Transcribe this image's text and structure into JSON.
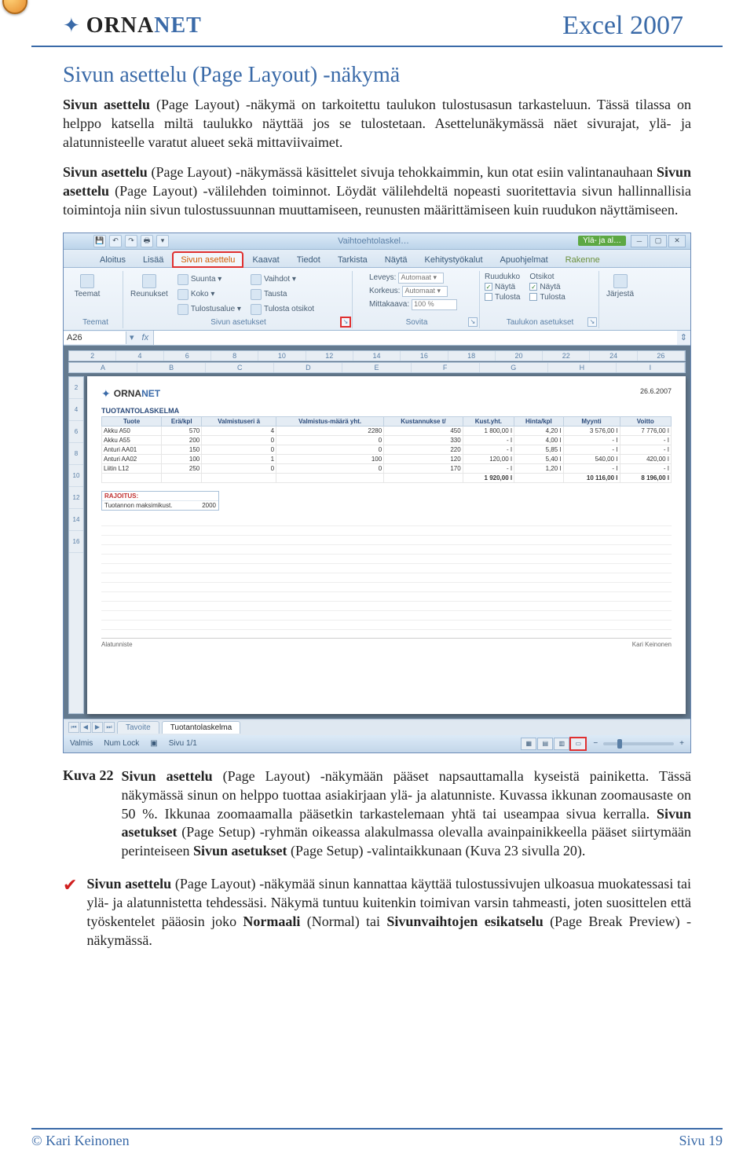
{
  "header": {
    "logo_text_a": "ORNA",
    "logo_text_b": "NET",
    "doc_title": "Excel 2007"
  },
  "section_title": "Sivun asettelu (Page Layout) -näkymä",
  "para1_lead": "Sivun asettelu",
  "para1_rest": " (Page Layout) -näkymä on tarkoitettu taulukon tulostusasun tarkasteluun. Tässä tilassa on helppo katsella miltä taulukko näyttää jos se tulostetaan. Asettelunäkymässä näet sivurajat, ylä- ja alatunnisteelle varatut alueet sekä mittaviivaimet.",
  "para2_lead": "Sivun asettelu",
  "para2_mid1": " (Page Layout) -näkymässä käsittelet sivuja tehokkaimmin, kun otat esiin valintanauhaan ",
  "para2_bold2": "Sivun asettelu",
  "para2_rest": " (Page Layout) -välilehden toiminnot. Löydät välilehdeltä nopeasti suoritettavia sivun hallinnallisia toimintoja niin sivun tulostussuunnan muuttamiseen, reunusten määrittämiseen kuin ruudukon näyttämiseen.",
  "excel": {
    "titlebar_doc": "Vaihtoehtolaskel…",
    "yal_label": "Ylä- ja al…",
    "tabs": [
      "Aloitus",
      "Lisää",
      "Sivun asettelu",
      "Kaavat",
      "Tiedot",
      "Tarkista",
      "Näytä",
      "Kehitystyökalut",
      "Apuohjelmat",
      "Rakenne"
    ],
    "grp_teemat": "Teemat",
    "btn_teemat": "Teemat",
    "btn_reunukset": "Reunukset",
    "btn_suunta": "Suunta ▾",
    "btn_koko": "Koko ▾",
    "btn_tulostusalue": "Tulostusalue ▾",
    "btn_vaihdot": "Vaihdot ▾",
    "btn_tausta": "Tausta",
    "btn_tulostaotsikot": "Tulosta otsikot",
    "grp_sivunasetukset": "Sivun asetukset",
    "lbl_leveys": "Leveys:",
    "val_leveys": "Automaat ▾",
    "lbl_korkeus": "Korkeus:",
    "val_korkeus": "Automaat ▾",
    "lbl_mittakaava": "Mittakaava:",
    "val_mittakaava": "100 %",
    "grp_sovita": "Sovita",
    "col_ruudukko": "Ruudukko",
    "col_otsikot": "Otsikot",
    "chk_nayta": "Näytä",
    "chk_tulosta": "Tulosta",
    "grp_taulukonasetukset": "Taulukon asetukset",
    "btn_jarjesta": "Järjestä",
    "namebox": "A26",
    "fx": "fx",
    "ruler_cols": [
      "2",
      "4",
      "6",
      "8",
      "10",
      "12",
      "14",
      "16",
      "18",
      "20",
      "22",
      "24",
      "26"
    ],
    "col_letters": [
      "A",
      "B",
      "C",
      "D",
      "E",
      "F",
      "G",
      "H",
      "I"
    ],
    "vruler": [
      "2",
      "4",
      "6",
      "8",
      "10",
      "12",
      "14",
      "16"
    ],
    "paper_date": "26.6.2007",
    "calc_title": "TUOTANTOLASKELMA",
    "headers": [
      "Tuote",
      "Erä/kpl",
      "Valmistuseri ä",
      "Valmistus-määrä yht.",
      "Kustannukse t/",
      "Kust.yht.",
      "Hinta/kpl",
      "Myynti",
      "Voitto"
    ],
    "rows": [
      [
        "Akku A50",
        "570",
        "4",
        "2280",
        "450",
        "1 800,00 I",
        "4,20 I",
        "3 576,00 I",
        "7 776,00 I"
      ],
      [
        "Akku A55",
        "200",
        "0",
        "0",
        "330",
        "- I",
        "4,00 I",
        "- I",
        "- I"
      ],
      [
        "Anturi AA01",
        "150",
        "0",
        "0",
        "220",
        "- I",
        "5,85 I",
        "- I",
        "- I"
      ],
      [
        "Anturi AA02",
        "100",
        "1",
        "100",
        "120",
        "120,00 I",
        "5,40 I",
        "540,00 I",
        "420,00 I"
      ],
      [
        "Liitin L12",
        "250",
        "0",
        "0",
        "170",
        "- I",
        "1,20 I",
        "- I",
        "- I"
      ]
    ],
    "total_row": [
      "",
      "",
      "",
      "",
      "",
      "1 920,00 I",
      "",
      "10 116,00 I",
      "8 196,00 I"
    ],
    "rajoitus_title": "RAJOITUS:",
    "rajoitus_label": "Tuotannon maksimikust.",
    "rajoitus_val": "2000",
    "footer_left": "Alatunniste",
    "footer_right": "Kari Keinonen",
    "sheettab_inactive": "Tavoite",
    "sheettab_active": "Tuotantolaskelma",
    "status_valmis": "Valmis",
    "status_numlock": "Num Lock",
    "status_sivu": "Sivu 1/1"
  },
  "caption_label": "Kuva 22",
  "caption_lead": "Sivun asettelu",
  "caption_mid1": " (Page Layout) -näkymään pääset napsauttamalla kyseistä painiketta. Tässä näkymässä sinun on helppo tuottaa asiakirjaan ylä- ja alatunniste. Kuvassa ikkunan zoomausaste on 50 %. Ikkunaa zoomaamalla pääsetkin tarkastelemaan yhtä tai useampaa sivua kerralla. ",
  "caption_bold2": "Sivun asetukset",
  "caption_mid2": " (Page Setup) -ryhmän oikeassa alakulmassa olevalla avainpainikkeella pääset siirtymään perinteiseen ",
  "caption_bold3": "Sivun asetukset",
  "caption_rest": " (Page Setup) -valintaikkunaan (Kuva 23 sivulla 20).",
  "tip_lead": "Sivun asettelu",
  "tip_mid1": " (Page Layout) -näkymää sinun kannattaa käyttää tulostussivujen ulkoasua muokatessasi tai ylä- ja alatunnistetta tehdessäsi. Näkymä tuntuu kuitenkin toimivan varsin tahmeasti, joten suosittelen että työskentelet pääosin joko ",
  "tip_bold2": "Normaali",
  "tip_mid2": " (Normal) tai ",
  "tip_bold3": "Sivunvaihtojen esikatselu",
  "tip_rest": " (Page Break Preview) -näkymässä.",
  "footer": {
    "left": "© Kari Keinonen",
    "right": "Sivu 19"
  }
}
